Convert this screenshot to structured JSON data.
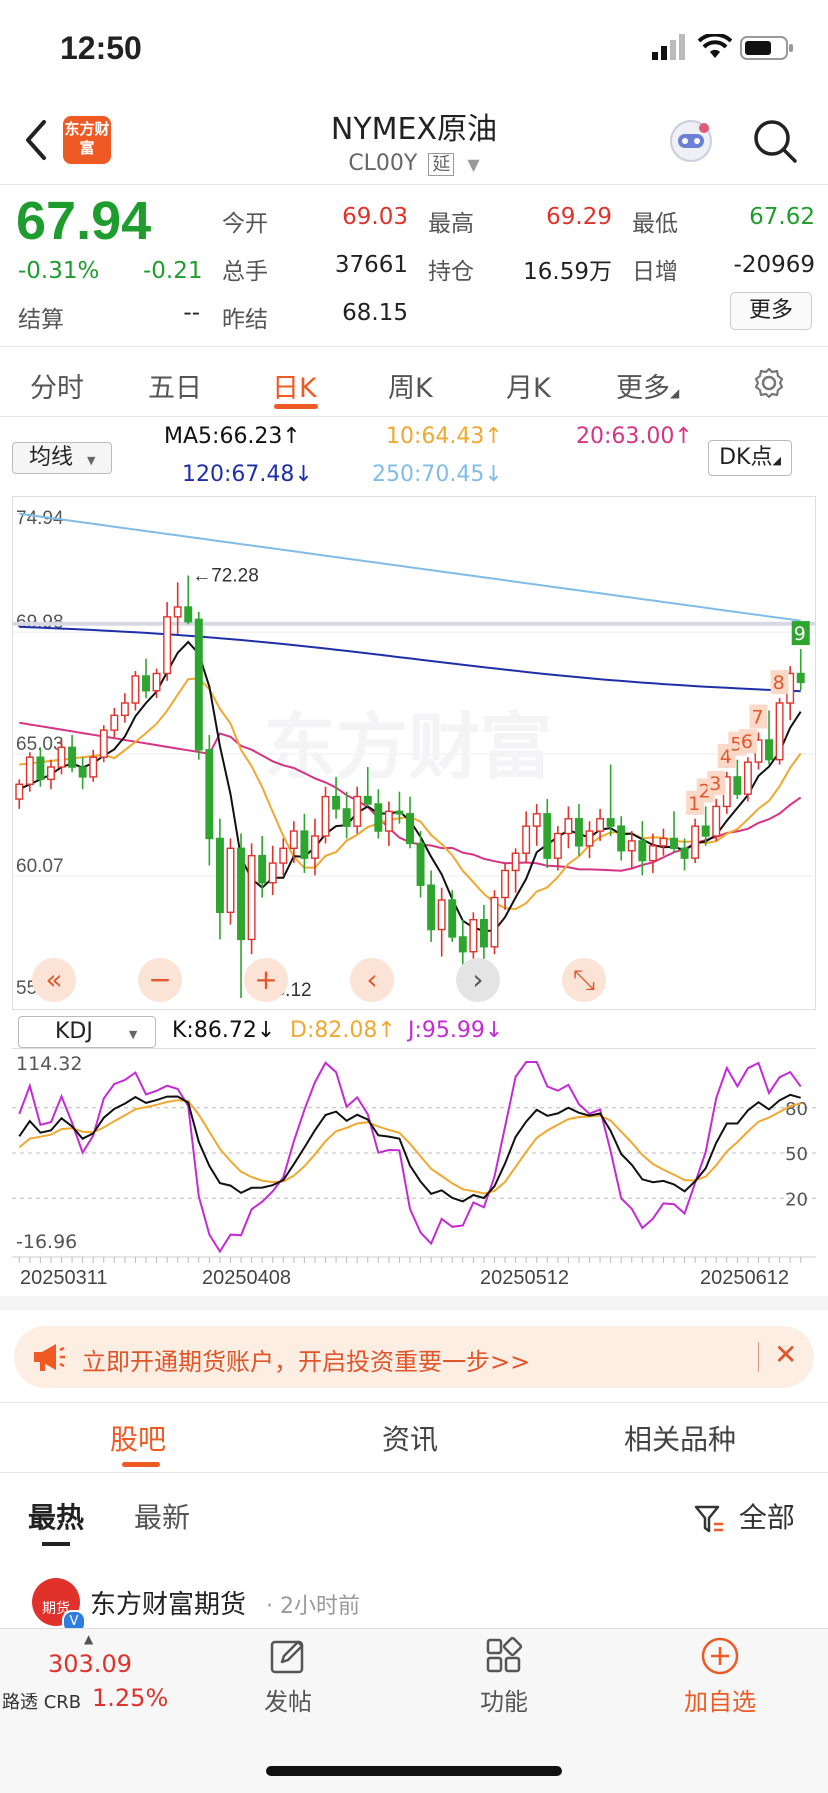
{
  "status": {
    "time": "12:50"
  },
  "header": {
    "logo_text": "东方财富",
    "title": "NYMEX原油",
    "subtitle": "CL00Y",
    "subtitle_tag": "延"
  },
  "quote": {
    "price": "67.94",
    "change_pct": "-0.31%",
    "change": "-0.21",
    "settle_label": "结算",
    "settle_value": "--",
    "rows": [
      [
        {
          "label": "今开",
          "value": "69.03",
          "color": "red"
        },
        {
          "label": "最高",
          "value": "69.29",
          "color": "red"
        },
        {
          "label": "最低",
          "value": "67.62",
          "color": "green"
        }
      ],
      [
        {
          "label": "总手",
          "value": "37661",
          "color": "dark"
        },
        {
          "label": "持仓",
          "value": "16.59万",
          "color": "dark"
        },
        {
          "label": "日增",
          "value": "-20969",
          "color": "dark"
        }
      ],
      [
        {
          "label": "昨结",
          "value": "68.15",
          "color": "dark"
        }
      ]
    ],
    "more_button": "更多"
  },
  "tabs": [
    "分时",
    "五日",
    "日K",
    "周K",
    "月K",
    "更多"
  ],
  "active_tab": 2,
  "ma": {
    "selector": "均线",
    "dk_button": "DK点",
    "ma5": "MA5:66.23",
    "ma10": "10:64.43",
    "ma20": "20:63.00",
    "ma120": "120:67.48",
    "ma250": "250:70.45",
    "colors": {
      "ma5": "#111111",
      "ma10": "#f0a830",
      "ma20": "#d63384",
      "ma120": "#1f2fa8",
      "ma250": "#7fbde8"
    }
  },
  "kchart": {
    "y_ticks": [
      "74.94",
      "69.98",
      "65.03",
      "60.07",
      "55.12"
    ],
    "high_label": "←72.28",
    "low_label": "←55.12",
    "watermark": "东方财富",
    "seq_labels": [
      "1",
      "2",
      "3",
      "4",
      "5",
      "6",
      "7",
      "8",
      "9"
    ]
  },
  "chart_data": {
    "type": "candlestick",
    "ylim": [
      55.12,
      74.94
    ],
    "max_marker": 72.28,
    "min_marker": 55.12,
    "candles": [
      [
        63.2,
        64.0,
        62.8,
        63.8
      ],
      [
        63.8,
        65.1,
        63.5,
        64.9
      ],
      [
        64.9,
        65.3,
        63.7,
        64.0
      ],
      [
        64.0,
        64.8,
        63.6,
        64.5
      ],
      [
        64.5,
        65.6,
        64.2,
        65.3
      ],
      [
        65.3,
        65.8,
        64.3,
        64.5
      ],
      [
        64.5,
        64.9,
        63.6,
        64.1
      ],
      [
        64.1,
        65.2,
        63.9,
        64.9
      ],
      [
        64.9,
        66.2,
        64.7,
        66.0
      ],
      [
        66.0,
        66.9,
        65.7,
        66.6
      ],
      [
        66.6,
        67.5,
        66.3,
        67.1
      ],
      [
        67.1,
        68.4,
        66.8,
        68.2
      ],
      [
        68.2,
        68.9,
        67.3,
        67.6
      ],
      [
        67.6,
        68.5,
        67.3,
        68.3
      ],
      [
        68.3,
        71.2,
        68.0,
        70.6
      ],
      [
        70.6,
        72.0,
        69.9,
        71.0
      ],
      [
        71.0,
        72.28,
        70.3,
        70.4
      ],
      [
        70.5,
        70.8,
        64.8,
        65.2
      ],
      [
        65.2,
        65.8,
        60.5,
        61.6
      ],
      [
        61.6,
        62.4,
        57.5,
        58.6
      ],
      [
        58.6,
        61.6,
        58.1,
        61.2
      ],
      [
        61.2,
        61.8,
        55.12,
        57.5
      ],
      [
        57.5,
        61.4,
        56.9,
        60.9
      ],
      [
        60.9,
        61.7,
        59.2,
        59.8
      ],
      [
        59.8,
        61.3,
        59.3,
        60.6
      ],
      [
        60.6,
        61.6,
        60.1,
        61.2
      ],
      [
        61.2,
        62.3,
        60.6,
        61.9
      ],
      [
        61.9,
        62.6,
        60.2,
        60.8
      ],
      [
        60.8,
        62.4,
        60.1,
        61.7
      ],
      [
        61.7,
        63.7,
        61.4,
        63.3
      ],
      [
        63.3,
        64.1,
        62.4,
        62.8
      ],
      [
        62.8,
        63.5,
        61.6,
        62.1
      ],
      [
        62.1,
        63.7,
        61.8,
        63.3
      ],
      [
        63.3,
        64.5,
        62.9,
        63.0
      ],
      [
        63.0,
        63.6,
        61.6,
        61.9
      ],
      [
        61.9,
        63.1,
        61.3,
        62.7
      ],
      [
        62.7,
        63.5,
        62.2,
        62.6
      ],
      [
        62.6,
        63.3,
        61.2,
        61.4
      ],
      [
        61.4,
        61.9,
        59.2,
        59.7
      ],
      [
        59.7,
        60.3,
        57.4,
        57.9
      ],
      [
        57.9,
        59.6,
        56.8,
        59.1
      ],
      [
        59.1,
        59.5,
        57.4,
        57.6
      ],
      [
        57.6,
        58.3,
        56.0,
        57.0
      ],
      [
        57.0,
        58.6,
        56.4,
        58.3
      ],
      [
        58.3,
        58.9,
        56.7,
        57.2
      ],
      [
        57.2,
        59.5,
        56.9,
        59.2
      ],
      [
        59.2,
        60.6,
        58.7,
        60.3
      ],
      [
        60.3,
        61.2,
        59.4,
        61.0
      ],
      [
        61.0,
        62.7,
        60.6,
        62.1
      ],
      [
        62.1,
        63.0,
        61.3,
        62.6
      ],
      [
        62.6,
        63.2,
        60.4,
        60.8
      ],
      [
        60.8,
        62.1,
        60.3,
        61.8
      ],
      [
        61.8,
        62.9,
        61.2,
        62.4
      ],
      [
        62.4,
        63.0,
        60.9,
        61.3
      ],
      [
        61.3,
        62.3,
        60.8,
        61.9
      ],
      [
        61.9,
        62.8,
        61.5,
        62.4
      ],
      [
        62.4,
        64.6,
        61.7,
        62.1
      ],
      [
        62.1,
        62.5,
        60.7,
        61.1
      ],
      [
        61.1,
        61.9,
        60.4,
        61.5
      ],
      [
        61.5,
        62.3,
        60.1,
        60.7
      ],
      [
        60.7,
        61.8,
        60.2,
        61.3
      ],
      [
        61.3,
        62.0,
        60.9,
        61.6
      ],
      [
        61.6,
        62.7,
        61.0,
        61.2
      ],
      [
        61.2,
        61.6,
        60.3,
        60.8
      ],
      [
        60.8,
        62.4,
        60.6,
        62.1
      ],
      [
        62.1,
        62.9,
        61.3,
        61.7
      ],
      [
        61.7,
        63.2,
        61.5,
        62.9
      ],
      [
        62.9,
        64.3,
        62.6,
        64.1
      ],
      [
        64.1,
        64.8,
        63.2,
        63.4
      ],
      [
        63.4,
        64.9,
        63.1,
        64.7
      ],
      [
        64.7,
        65.9,
        64.4,
        65.6
      ],
      [
        65.6,
        66.8,
        64.6,
        64.8
      ],
      [
        64.8,
        67.3,
        64.6,
        67.1
      ],
      [
        67.1,
        68.6,
        66.4,
        68.3
      ],
      [
        68.3,
        69.29,
        67.62,
        67.94
      ]
    ],
    "kdj": {
      "ylim": [
        -16.96,
        114.32
      ],
      "levels": [
        80,
        50,
        20
      ],
      "K": "86.72",
      "D": "82.08",
      "J": "95.99"
    },
    "x_ticks": [
      "20250311",
      "20250408",
      "20250512",
      "20250612"
    ]
  },
  "kdj_header": {
    "selector": "KDJ",
    "k": "K:86.72",
    "d": "D:82.08",
    "j": "J:95.99"
  },
  "banner": {
    "text": "立即开通期货账户，开启投资重要一步>>"
  },
  "section_tabs": [
    "股吧",
    "资讯",
    "相关品种"
  ],
  "sub_tabs": {
    "hot": "最热",
    "new": "最新",
    "filter": "全部"
  },
  "post": {
    "author": "东方财富期货",
    "time": "· 2小时前",
    "avatar_text": "期货"
  },
  "bottom": {
    "crb_value": "303.09",
    "crb_label": "路透 CRB",
    "crb_change": "1.25%",
    "post": "发帖",
    "func": "功能",
    "add": "加自选"
  }
}
